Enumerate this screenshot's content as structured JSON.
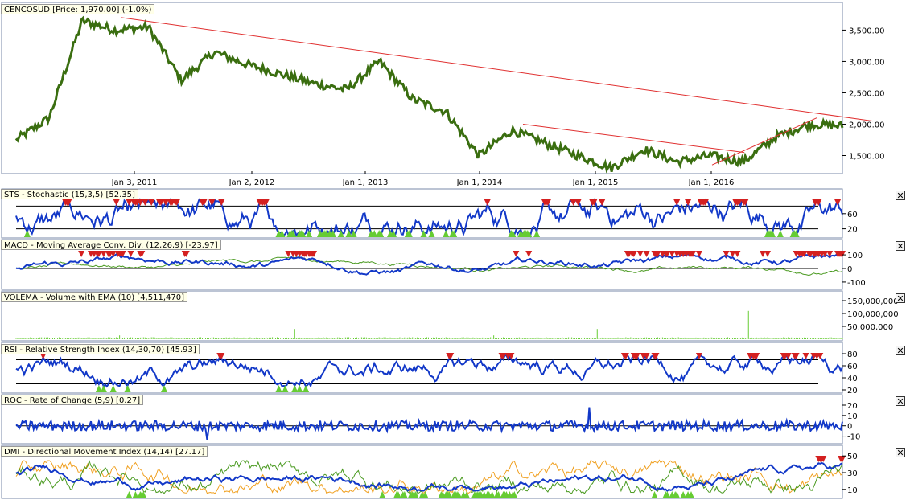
{
  "colors": {
    "price": "#3a6e10",
    "indicator": "#1238c8",
    "trend": "#e03030",
    "signal_up": "#66cc33",
    "signal_down": "#d42020",
    "orange": "#f0a020",
    "green_line": "#4a9a20",
    "level": "#000000",
    "border": "#7a8aa8"
  },
  "icons": {
    "close": "✕"
  },
  "main": {
    "title": "CENCOSUD [Price: 1,970.00] (-1.0%)",
    "y_labels": [
      "3,500.00",
      "3,000.00",
      "2,500.00",
      "2,000.00",
      "1,500.00"
    ],
    "y_values": [
      3500,
      3000,
      2500,
      2000,
      1500
    ],
    "x_labels": [
      "Jan 3, 2011",
      "Jan 2, 2012",
      "Jan 1, 2013",
      "Jan 1, 2014",
      "Jan 1, 2015",
      "Jan 1, 2016"
    ]
  },
  "chart_data": {
    "type": "line",
    "title": "CENCOSUD [Price: 1,970.00] (-1.0%)",
    "x": [
      "2010-07",
      "2010-10",
      "2011-01",
      "2011-04",
      "2011-07",
      "2011-10",
      "2012-01",
      "2012-04",
      "2012-07",
      "2012-10",
      "2013-01",
      "2013-04",
      "2013-07",
      "2013-10",
      "2014-01",
      "2014-04",
      "2014-07",
      "2014-10",
      "2015-01",
      "2015-04",
      "2015-07",
      "2015-10",
      "2016-01",
      "2016-04",
      "2016-07",
      "2016-10"
    ],
    "series": [
      {
        "values": [
          1750,
          2100,
          3650,
          3500,
          3550,
          2700,
          3150,
          2950,
          2800,
          2650,
          2550,
          3000,
          2400,
          2200,
          1500,
          1900,
          1700,
          1500,
          1300,
          1600,
          1400,
          1500,
          1400,
          1800,
          2000,
          1970
        ]
      }
    ],
    "ylim": [
      1250,
      3800
    ]
  },
  "panels": [
    {
      "title": "STS - Stochastic (15,3,5) [52.35]",
      "y_labels": [
        "60",
        "20"
      ]
    },
    {
      "title": "MACD - Moving Average Conv. Div. (12,26,9) [-23.97]",
      "y_labels": [
        "100",
        "0",
        "-100"
      ]
    },
    {
      "title": "VOLEMA - Volume with EMA (10) [4,511,470]",
      "y_labels": [
        "150,000,000",
        "100,000,000",
        "50,000,000"
      ]
    },
    {
      "title": "RSI - Relative Strength Index (14,30,70) [45.93]",
      "y_labels": [
        "80",
        "60",
        "40",
        "20"
      ]
    },
    {
      "title": "ROC - Rate of Change (5,9) [0.27]",
      "y_labels": [
        "20",
        "10",
        "0",
        "-10"
      ]
    },
    {
      "title": "DMI - Directional Movement Index (14,14) [27.17]",
      "y_labels": [
        "50",
        "30",
        "10"
      ]
    }
  ]
}
